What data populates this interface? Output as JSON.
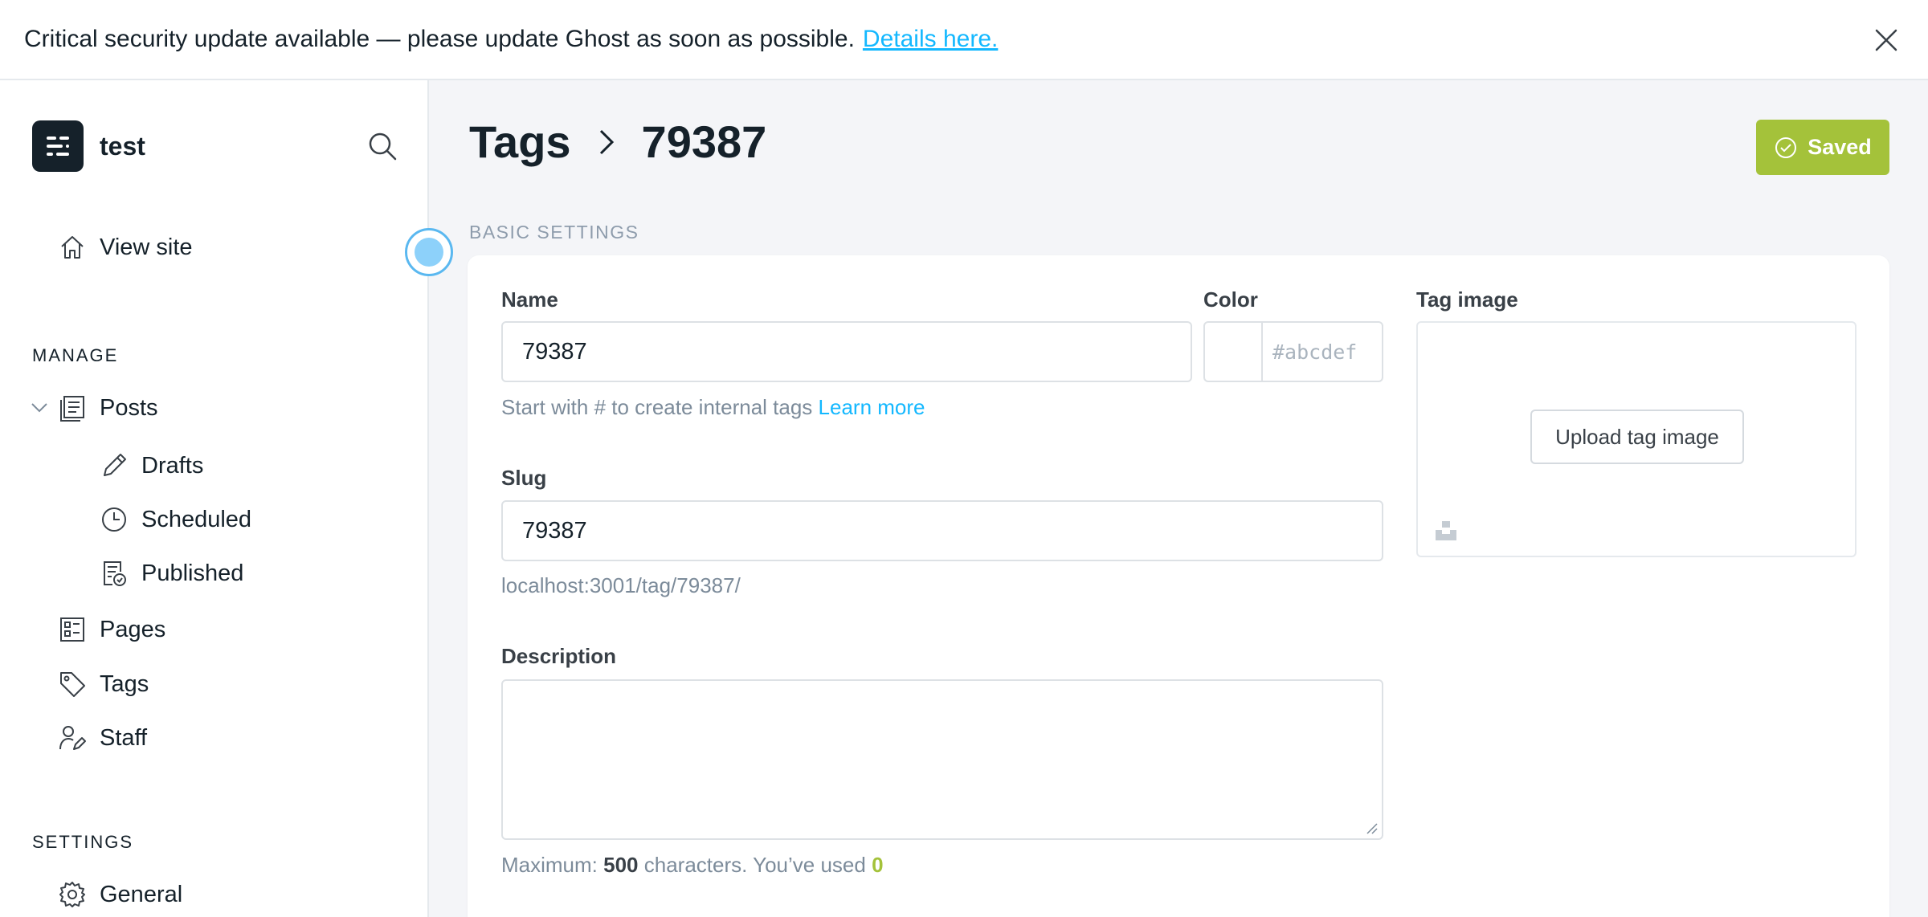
{
  "banner": {
    "message": "Critical security update available — please update Ghost as soon as possible.",
    "link": "Details here."
  },
  "sidebar": {
    "site_name": "test",
    "view_site": "View site",
    "manage_heading": "MANAGE",
    "posts": "Posts",
    "drafts": "Drafts",
    "scheduled": "Scheduled",
    "published": "Published",
    "pages": "Pages",
    "tags": "Tags",
    "staff": "Staff",
    "settings_heading": "SETTINGS",
    "general": "General"
  },
  "header": {
    "breadcrumb_parent": "Tags",
    "breadcrumb_current": "79387",
    "saved_label": "Saved"
  },
  "form": {
    "section_title": "BASIC SETTINGS",
    "name_label": "Name",
    "name_value": "79387",
    "name_help": "Start with # to create internal tags",
    "name_help_link": "Learn more",
    "color_label": "Color",
    "color_placeholder": "#abcdef",
    "image_label": "Tag image",
    "upload_label": "Upload tag image",
    "slug_label": "Slug",
    "slug_value": "79387",
    "slug_url": "localhost:3001/tag/79387/",
    "description_label": "Description",
    "description_value": "",
    "counter_prefix": "Maximum:",
    "counter_max": "500",
    "counter_mid": "characters. You’ve used",
    "counter_used": "0"
  },
  "colors": {
    "accent_green": "#a4c23a",
    "link_blue": "#14b8ff",
    "dark": "#15212a"
  }
}
